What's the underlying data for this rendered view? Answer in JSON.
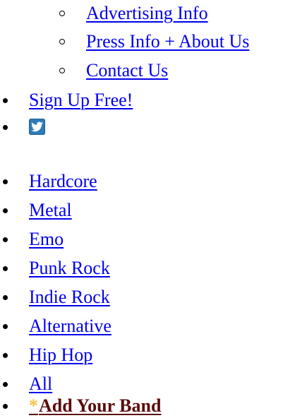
{
  "nav": {
    "sub_items": [
      {
        "label": "Advertising Info"
      },
      {
        "label": "Press Info + About Us"
      },
      {
        "label": "Contact Us"
      }
    ],
    "signup": {
      "label": "Sign Up Free!"
    },
    "twitter": {
      "icon": "twitter-bird-icon",
      "color": "#2d7bb8"
    }
  },
  "genres": {
    "items": [
      {
        "label": "Hardcore"
      },
      {
        "label": "Metal"
      },
      {
        "label": "Emo"
      },
      {
        "label": "Punk Rock"
      },
      {
        "label": "Indie Rock"
      },
      {
        "label": "Alternative"
      },
      {
        "label": "Hip Hop"
      },
      {
        "label": "All"
      }
    ],
    "add_band": {
      "star": "*",
      "label": "Add Your Band",
      "star_color": "#f5c14a",
      "label_color": "#5c0a0a"
    }
  },
  "colors": {
    "link": "#0000ee"
  }
}
